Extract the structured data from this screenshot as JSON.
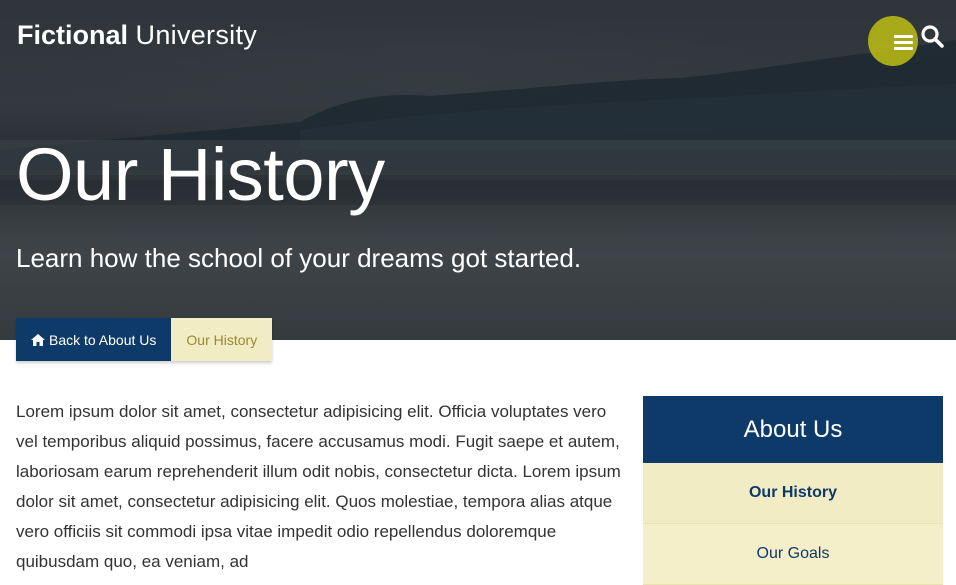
{
  "header": {
    "logo_bold": "Fictional",
    "logo_light": "University",
    "menu_icon": "hamburger-menu-icon",
    "search_icon": "search-icon",
    "accent_color": "#c4c412"
  },
  "hero": {
    "title": "Our History",
    "subtitle": "Learn how the school of your dreams got started."
  },
  "breadcrumb": {
    "back_icon": "home-icon",
    "back_label": "Back to About Us",
    "current_label": "Our History"
  },
  "content": {
    "text": "Lorem ipsum dolor sit amet, consectetur adipisicing elit. Officia voluptates vero vel temporibus aliquid possimus, facere accusamus modi. Fugit saepe et autem, laboriosam earum reprehenderit illum odit nobis, consectetur dicta. Lorem ipsum dolor sit amet, consectetur adipisicing elit. Quos molestiae, tempora alias atque vero officiis sit commodi ipsa vitae impedit odio repellendus doloremque quibusdam quo, ea veniam, ad"
  },
  "sidebar": {
    "title": "About Us",
    "items": [
      {
        "label": "Our History",
        "current": true
      },
      {
        "label": "Our Goals",
        "current": false
      }
    ]
  },
  "colors": {
    "primary_blue": "#0e3a6a",
    "beige": "#f2ecc4",
    "gold_text": "#9a8a2c"
  }
}
